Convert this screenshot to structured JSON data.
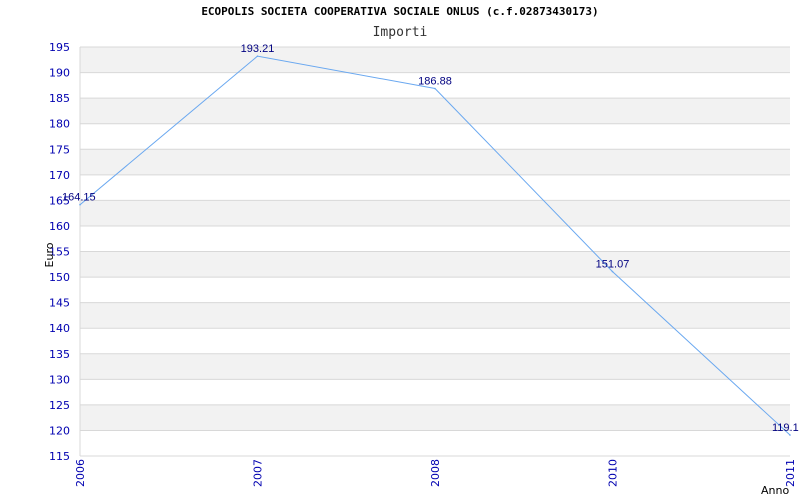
{
  "chart_data": {
    "type": "line",
    "title": "ECOPOLIS SOCIETA COOPERATIVA SOCIALE ONLUS (c.f.02873430173)",
    "subtitle": "Importi",
    "xlabel": "Anno",
    "ylabel": "Euro",
    "categories": [
      "2006",
      "2007",
      "2008",
      "2010",
      "2011"
    ],
    "series": [
      {
        "values": [
          164.15,
          193.21,
          186.88,
          151.07,
          119.1
        ]
      }
    ],
    "data_labels": [
      "164.15",
      "193.21",
      "186.88",
      "151.07",
      "119.1"
    ],
    "ylim": [
      115,
      195
    ],
    "ytick_step": 5,
    "grid": true,
    "colors": {
      "line": "#6aa8f0",
      "band": "#f2f2f2",
      "grid": "#d8d8d8",
      "tick": "#0000b0"
    }
  }
}
